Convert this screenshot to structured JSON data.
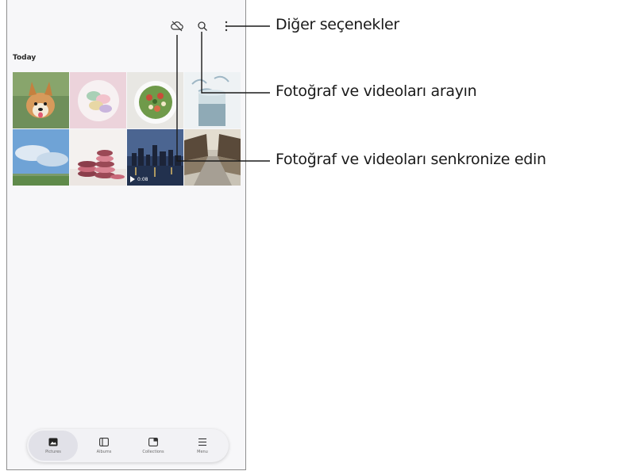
{
  "gallery": {
    "section_title": "Today",
    "video_duration": "0:08",
    "photos": [
      {
        "subject": "corgi dog on grass"
      },
      {
        "subject": "macarons on pink plate"
      },
      {
        "subject": "salad bowl"
      },
      {
        "subject": "water glass splash"
      },
      {
        "subject": "blue sky with clouds"
      },
      {
        "subject": "stacked macarons"
      },
      {
        "subject": "city night skyline video"
      },
      {
        "subject": "traditional street"
      }
    ]
  },
  "top_actions": [
    {
      "name": "sync-off-icon",
      "label": ""
    },
    {
      "name": "search-icon",
      "label": ""
    },
    {
      "name": "more-options-icon",
      "label": ""
    }
  ],
  "bottom_nav": {
    "items": [
      {
        "label": "Pictures",
        "icon": "pictures-icon",
        "active": true
      },
      {
        "label": "Albums",
        "icon": "albums-icon",
        "active": false
      },
      {
        "label": "Collections",
        "icon": "collections-icon",
        "active": false
      },
      {
        "label": "Menu",
        "icon": "menu-icon",
        "active": false
      }
    ]
  },
  "callouts": {
    "more_options": "Diğer seçenekler",
    "search": "Fotoğraf ve videoları arayın",
    "sync": "Fotoğraf ve videoları senkronize edin"
  },
  "colors": {
    "frame_border": "#8f8f8f",
    "screen_bg": "#f7f7f9",
    "nav_active": "#e1e1e8",
    "callout_line": "#1a1a1a"
  }
}
